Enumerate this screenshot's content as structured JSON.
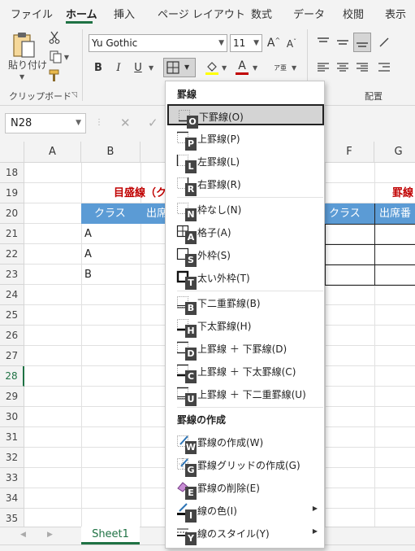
{
  "ribbon": {
    "tabs": [
      "ファイル",
      "ホーム",
      "挿入",
      "ページ レイアウト",
      "数式",
      "データ",
      "校閲",
      "表示"
    ],
    "active_tab": "ホーム",
    "paste_label": "貼り付け",
    "clipboard_group": "クリップボード",
    "alignment_group": "配置",
    "font_name": "Yu Gothic",
    "font_size": "11",
    "grow_font": "A",
    "shrink_font": "A",
    "bold": "B",
    "italic": "I",
    "underline": "U",
    "font_color_letter": "A",
    "phonetic": "ア亜"
  },
  "formula_bar": {
    "name_box": "N28"
  },
  "grid": {
    "columns": [
      "A",
      "B",
      "F",
      "G"
    ],
    "rows": [
      "18",
      "19",
      "20",
      "21",
      "22",
      "23",
      "24",
      "25",
      "26",
      "27",
      "28",
      "29",
      "30",
      "31",
      "32",
      "33",
      "34",
      "35"
    ],
    "selected_row": "28",
    "title_left": "目盛線（ク",
    "title_right": "罫線",
    "header_left": [
      "クラス",
      "出席"
    ],
    "header_right": [
      "クラス",
      "出席番"
    ],
    "class_values": [
      "A",
      "A",
      "B"
    ]
  },
  "sheet_tabs": [
    "Sheet1"
  ],
  "border_menu": {
    "section1_title": "罫線",
    "section2_title": "罫線の作成",
    "items": [
      {
        "label": "下罫線(O)",
        "key": "O",
        "icon": "bottom-border-icon",
        "highlighted": true
      },
      {
        "label": "上罫線(P)",
        "key": "P",
        "icon": "top-border-icon"
      },
      {
        "label": "左罫線(L)",
        "key": "L",
        "icon": "left-border-icon"
      },
      {
        "label": "右罫線(R)",
        "key": "R",
        "icon": "right-border-icon"
      },
      {
        "label": "枠なし(N)",
        "key": "N",
        "icon": "no-border-icon"
      },
      {
        "label": "格子(A)",
        "key": "A",
        "icon": "all-borders-icon"
      },
      {
        "label": "外枠(S)",
        "key": "S",
        "icon": "outside-borders-icon"
      },
      {
        "label": "太い外枠(T)",
        "key": "T",
        "icon": "thick-box-border-icon"
      },
      {
        "label": "下二重罫線(B)",
        "key": "B",
        "icon": "bottom-double-border-icon"
      },
      {
        "label": "下太罫線(H)",
        "key": "H",
        "icon": "thick-bottom-border-icon"
      },
      {
        "label": "上罫線 ＋ 下罫線(D)",
        "key": "D",
        "icon": "top-bottom-border-icon"
      },
      {
        "label": "上罫線 ＋ 下太罫線(C)",
        "key": "C",
        "icon": "top-thick-bottom-border-icon"
      },
      {
        "label": "上罫線 ＋ 下二重罫線(U)",
        "key": "U",
        "icon": "top-double-bottom-border-icon"
      },
      {
        "label": "罫線の作成(W)",
        "key": "W",
        "icon": "draw-border-icon"
      },
      {
        "label": "罫線グリッドの作成(G)",
        "key": "G",
        "icon": "draw-border-grid-icon"
      },
      {
        "label": "罫線の削除(E)",
        "key": "E",
        "icon": "erase-border-icon"
      },
      {
        "label": "線の色(I)",
        "key": "I",
        "icon": "line-color-icon",
        "submenu": true
      },
      {
        "label": "線のスタイル(Y)",
        "key": "Y",
        "icon": "line-style-icon",
        "submenu": true
      }
    ]
  },
  "colors": {
    "accent_green": "#1f7244",
    "header_fill": "#5b9bd5",
    "title_red": "#c00000"
  }
}
